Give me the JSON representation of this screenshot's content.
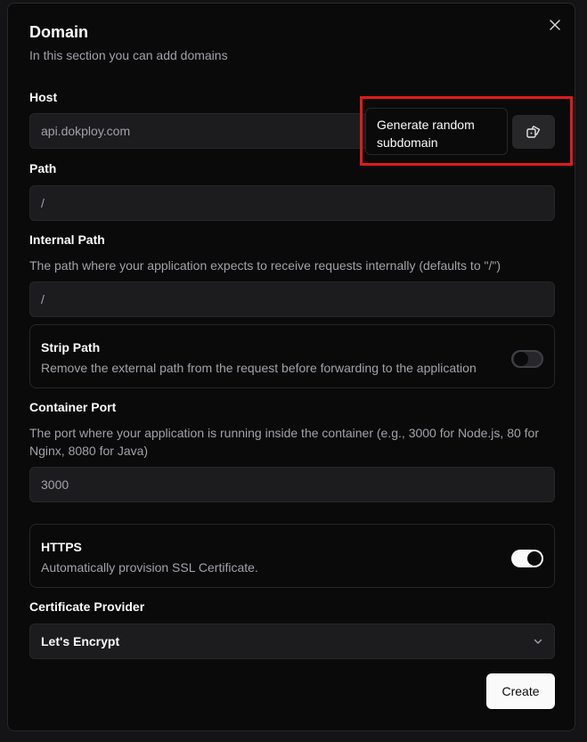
{
  "dialog": {
    "title": "Domain",
    "description": "In this section you can add domains"
  },
  "host": {
    "label": "Host",
    "value": "api.dokploy.com",
    "tooltip": "Generate random subdomain",
    "icon": "dice-icon"
  },
  "path": {
    "label": "Path",
    "value": "/"
  },
  "internal_path": {
    "label": "Internal Path",
    "help": "The path where your application expects to receive requests internally (defaults to \"/\")",
    "value": "/"
  },
  "strip_path": {
    "title": "Strip Path",
    "description": "Remove the external path from the request before forwarding to the application",
    "enabled": false
  },
  "container_port": {
    "label": "Container Port",
    "help": "The port where your application is running inside the container (e.g., 3000 for Node.js, 80 for Nginx, 8080 for Java)",
    "value": "3000"
  },
  "https": {
    "title": "HTTPS",
    "description": "Automatically provision SSL Certificate.",
    "enabled": true
  },
  "certificate_provider": {
    "label": "Certificate Provider",
    "selected": "Let's Encrypt"
  },
  "actions": {
    "create_label": "Create"
  },
  "colors": {
    "background": "#0a0a0a",
    "input_bg": "#1c1c1f",
    "border": "#27272a",
    "muted_text": "#a1a1aa",
    "foreground": "#fafafa",
    "highlight": "#e01b1b"
  }
}
